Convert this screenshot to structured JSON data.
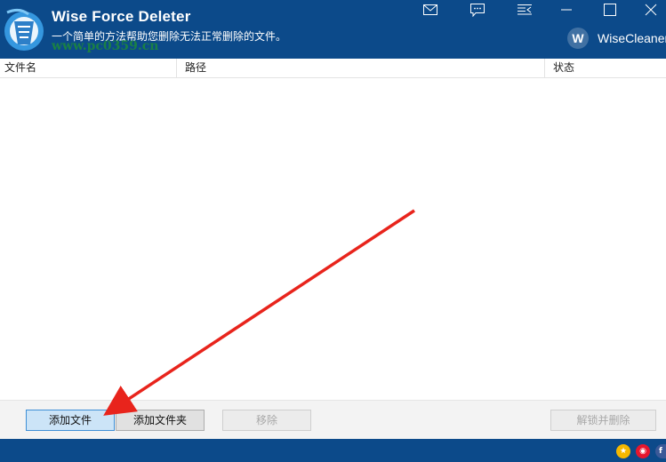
{
  "app": {
    "title": "Wise Force Deleter",
    "subtitle": "一个简单的方法帮助您删除无法正常删除的文件。",
    "watermark": "www.pc0359.cn",
    "brand": "WiseCleaner",
    "brand_initial": "W"
  },
  "window_controls": [
    "mail-icon",
    "feedback-icon",
    "menu-icon",
    "minimize-icon",
    "maximize-icon",
    "close-icon"
  ],
  "table": {
    "columns": [
      "文件名",
      "路径",
      "状态"
    ],
    "rows": []
  },
  "buttons": {
    "add_file": "添加文件",
    "add_folder": "添加文件夹",
    "remove": "移除",
    "unlock_delete": "解锁并删除"
  },
  "social_icons": [
    "like-icon",
    "weibo-icon",
    "facebook-icon"
  ],
  "colors": {
    "header_bg": "#0c4a8a",
    "annotation_arrow": "#e8241c"
  }
}
